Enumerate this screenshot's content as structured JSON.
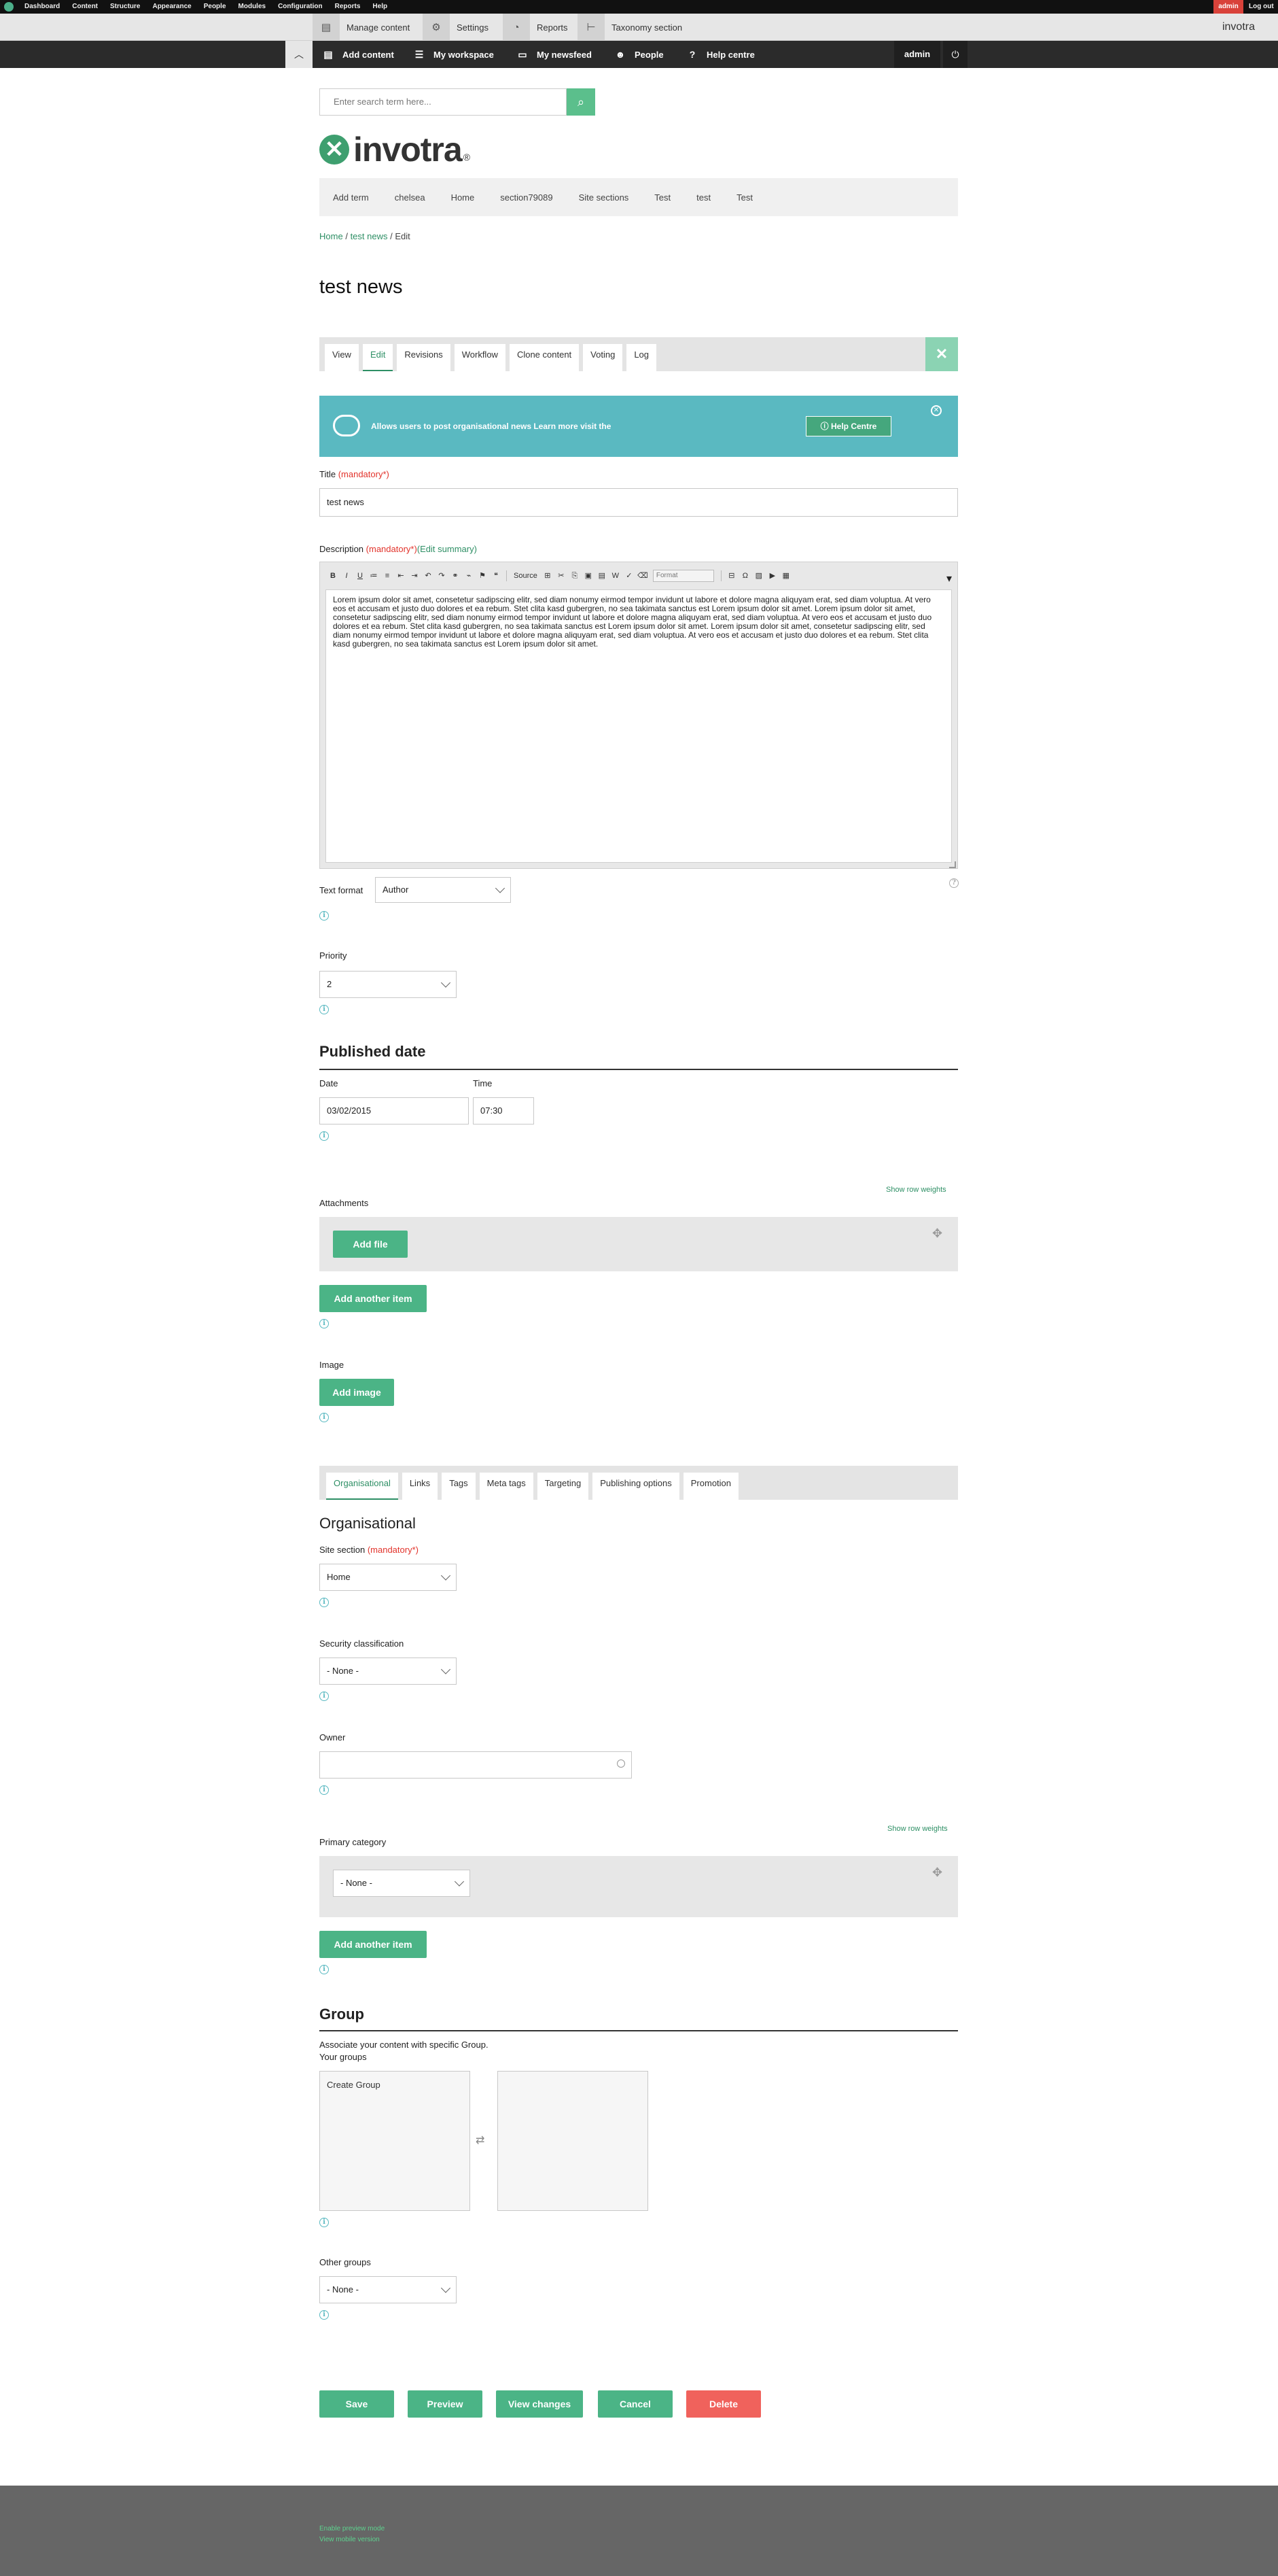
{
  "admin_bar": {
    "menu": [
      "Dashboard",
      "Content",
      "Structure",
      "Appearance",
      "People",
      "Modules",
      "Configuration",
      "Reports",
      "Help"
    ],
    "user": "admin",
    "logout": "Log out"
  },
  "toolbar_top": {
    "items": [
      "Manage content",
      "Settings",
      "Reports",
      "Taxonomy section"
    ],
    "brand": "invotra"
  },
  "toolbar_bottom": {
    "items": [
      "Add content",
      "My workspace",
      "My newsfeed",
      "People",
      "Help centre"
    ],
    "user": "admin"
  },
  "search": {
    "placeholder": "Enter search term here..."
  },
  "logo": {
    "text": "invotra",
    "reg": "®"
  },
  "main_nav": [
    "Add term",
    "chelsea",
    "Home",
    "section79089",
    "Site sections",
    "Test",
    "test",
    "Test"
  ],
  "breadcrumb": {
    "home": "Home",
    "parent": "test news",
    "sep": "/",
    "current": "Edit"
  },
  "page_title": "test news",
  "tabs": [
    "View",
    "Edit",
    "Revisions",
    "Workflow",
    "Clone content",
    "Voting",
    "Log"
  ],
  "banner": {
    "text": "Allows users to post organisational news Learn more visit the",
    "button": "Help Centre"
  },
  "form": {
    "title_label": "Title",
    "mandatory": "(mandatory*)",
    "title_value": "test news",
    "description_label": "Description",
    "edit_summary": "(Edit summary)",
    "editor_source": "Source",
    "editor_format": "Format",
    "description_value": "Lorem ipsum dolor sit amet, consetetur sadipscing elitr, sed diam nonumy eirmod tempor invidunt ut labore et dolore magna aliquyam erat, sed diam voluptua. At vero eos et accusam et justo duo dolores et ea rebum. Stet clita kasd gubergren, no sea takimata sanctus est Lorem ipsum dolor sit amet. Lorem ipsum dolor sit amet, consetetur sadipscing elitr, sed diam nonumy eirmod tempor invidunt ut labore et dolore magna aliquyam erat, sed diam voluptua. At vero eos et accusam et justo duo dolores et ea rebum. Stet clita kasd gubergren, no sea takimata sanctus est Lorem ipsum dolor sit amet. Lorem ipsum dolor sit amet, consetetur sadipscing elitr, sed diam nonumy eirmod tempor invidunt ut labore et dolore magna aliquyam erat, sed diam voluptua. At vero eos et accusam et justo duo dolores et ea rebum. Stet clita kasd gubergren, no sea takimata sanctus est Lorem ipsum dolor sit amet.",
    "text_format_label": "Text format",
    "text_format_value": "Author",
    "priority_label": "Priority",
    "priority_value": "2",
    "published_date_title": "Published date",
    "date_label": "Date",
    "date_value": "03/02/2015",
    "time_label": "Time",
    "time_value": "07:30",
    "show_row_weights": "Show row weights",
    "attachments_label": "Attachments",
    "add_file": "Add file",
    "add_another_item": "Add another item",
    "image_label": "Image",
    "add_image": "Add image"
  },
  "vertical_tabs": [
    "Organisational",
    "Links",
    "Tags",
    "Meta tags",
    "Targeting",
    "Publishing options",
    "Promotion"
  ],
  "organisational": {
    "title": "Organisational",
    "site_section_label": "Site section",
    "site_section_value": "Home",
    "security_label": "Security classification",
    "security_value": "- None -",
    "owner_label": "Owner",
    "owner_value": "",
    "primary_category_label": "Primary category",
    "primary_category_value": "- None -"
  },
  "group": {
    "title": "Group",
    "description": "Associate your content with specific Group.",
    "your_groups_label": "Your groups",
    "your_groups_items": [
      "Create Group"
    ],
    "other_groups_label": "Other groups",
    "other_groups_value": "- None -"
  },
  "actions": [
    "Save",
    "Preview",
    "View changes",
    "Cancel",
    "Delete"
  ],
  "footer": [
    "Enable preview mode",
    "View mobile version"
  ],
  "colors": {
    "accent_green": "#4bb486",
    "banner_teal": "#5ab9c1",
    "delete_red": "#f0625c",
    "mandatory_red": "#e2332b",
    "link_green": "#2e8f65"
  }
}
